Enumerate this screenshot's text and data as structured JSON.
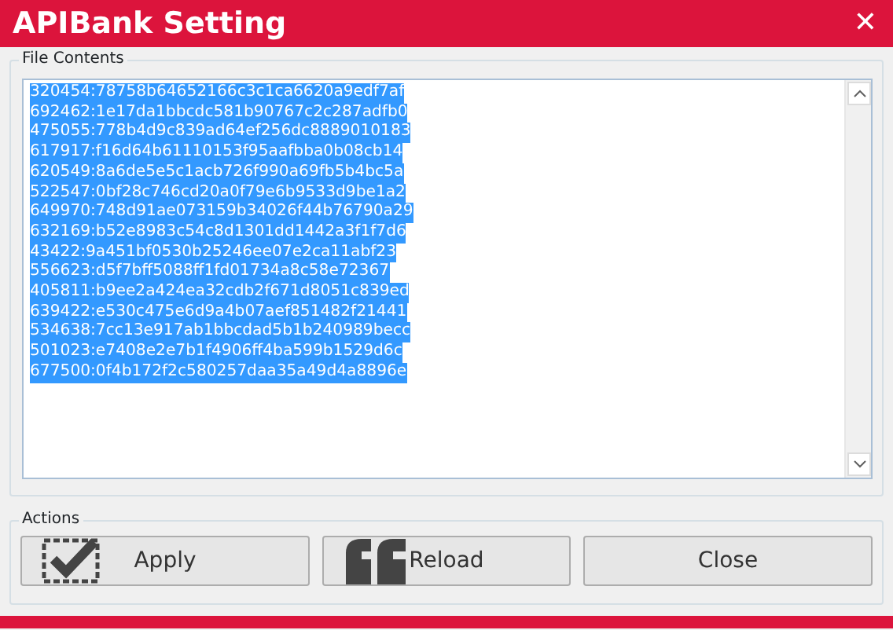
{
  "window": {
    "title": "APIBank Setting",
    "close": "✕"
  },
  "file_contents": {
    "label": "File Contents",
    "selected": true,
    "lines": [
      "320454:78758b64652166c3c1ca6620a9edf7af",
      "692462:1e17da1bbcdc581b90767c2c287adfb0",
      "475055:778b4d9c839ad64ef256dc8889010183",
      "617917:f16d64b61110153f95aafbba0b08cb14",
      "620549:8a6de5e5c1acb726f990a69fb5b4bc5a",
      "522547:0bf28c746cd20a0f79e6b9533d9be1a2",
      "649970:748d91ae073159b34026f44b76790a29",
      "632169:b52e8983c54c8d1301dd1442a3f1f7d6",
      "43422:9a451bf0530b25246ee07e2ca11abf23",
      "556623:d5f7bff5088ff1fd01734a8c58e72367",
      "405811:b9ee2a424ea32cdb2f671d8051c839ed",
      "639422:e530c475e6d9a4b07aef851482f21441",
      "534638:7cc13e917ab1bbcdad5b1b240989becc",
      "501023:e7408e2e7b1f4906ff4ba599b1529d6c",
      "677500:0f4b172f2c580257daa35a49d4a8896e"
    ]
  },
  "actions": {
    "label": "Actions",
    "buttons": [
      {
        "label": "Apply",
        "kind": "check"
      },
      {
        "label": "Reload",
        "kind": "quote"
      },
      {
        "label": "Close",
        "kind": "plain"
      }
    ]
  }
}
